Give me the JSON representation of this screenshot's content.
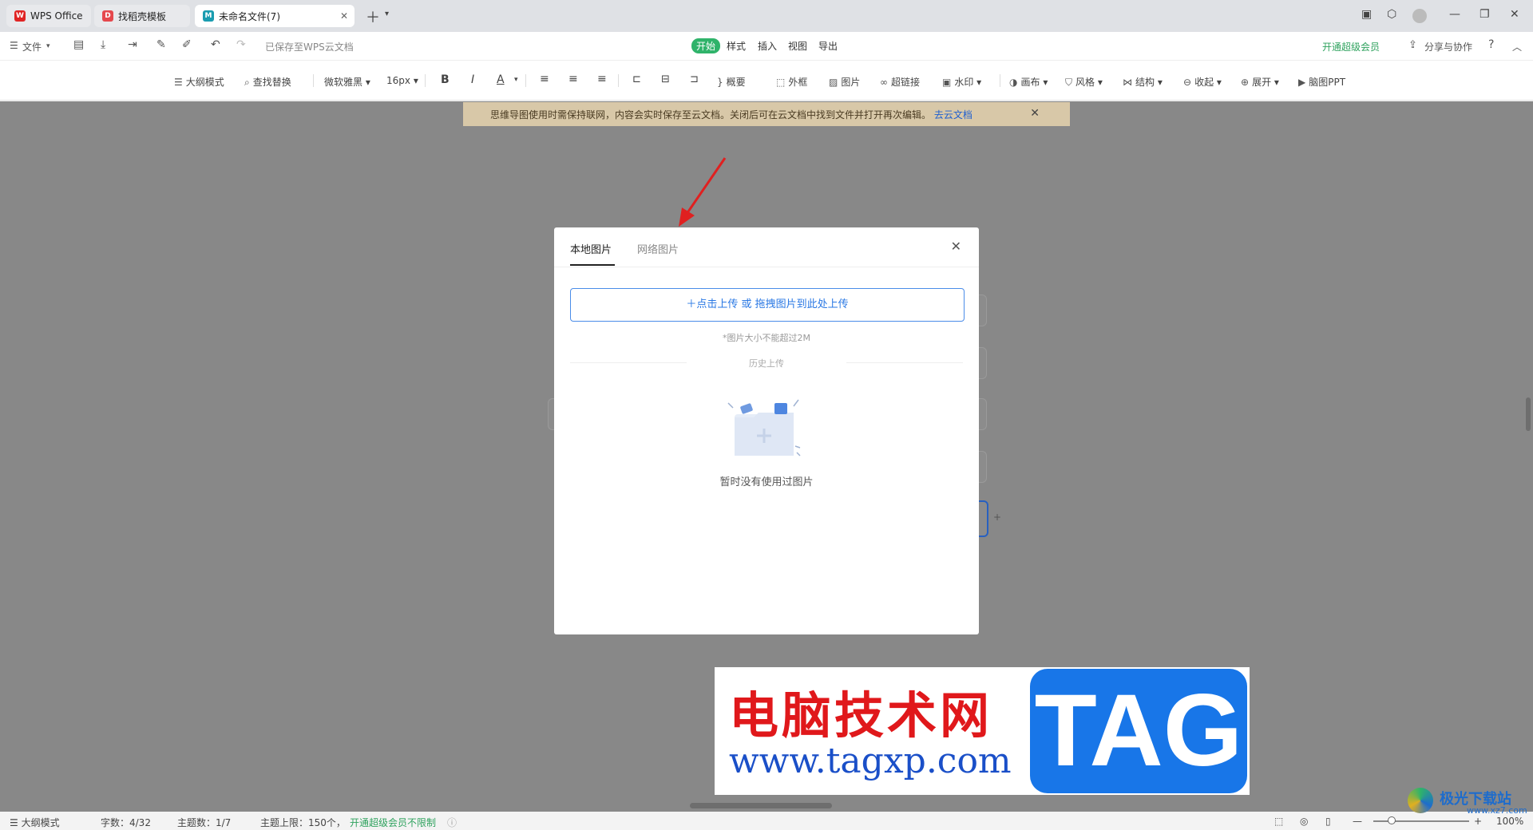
{
  "tabs": [
    {
      "label": "WPS Office"
    },
    {
      "label": "找稻壳模板"
    },
    {
      "label": "未命名文件(7)"
    }
  ],
  "menu": {
    "file": "文件",
    "saved": "已保存至WPS云文档",
    "tabs": [
      "开始",
      "样式",
      "插入",
      "视图",
      "导出"
    ],
    "vip": "开通超级会员",
    "share": "分享与协作",
    "help": "?"
  },
  "toolbar": {
    "outline": "大纲模式",
    "find": "查找替换",
    "font": "微软雅黑",
    "size": "16px",
    "bold": "B",
    "italic": "I",
    "color": "A",
    "summary": "概要",
    "frame": "外框",
    "image": "图片",
    "link": "超链接",
    "watermark": "水印",
    "canvas": "画布",
    "style": "风格",
    "structure": "结构",
    "collapse": "收起",
    "expand": "展开",
    "ppt": "脑图PPT"
  },
  "banner": {
    "text": "思维导图使用时需保持联网，内容会实时保存至云文档。关闭后可在云文档中找到文件并打开再次编辑。",
    "link": "去云文档",
    "close": "✕"
  },
  "dialog": {
    "tab_local": "本地图片",
    "tab_web": "网络图片",
    "close": "✕",
    "upload": "＋点击上传 或 拖拽图片到此处上传",
    "hint": "*图片大小不能超过2M",
    "history": "历史上传",
    "empty": "暂时没有使用过图片"
  },
  "status": {
    "outline": "大纲模式",
    "words": "字数：4/32",
    "topics": "主题数：1/7",
    "limit": "主题上限：150个，",
    "vip": "开通超级会员不限制",
    "zoom": "100%"
  },
  "watermark": {
    "cn": "电脑技术网",
    "url": "www.tagxp.com",
    "tag": "TAG",
    "site": "极光下载站",
    "site_url": "www.xz7.com"
  },
  "colors": {
    "accent": "#2fb36a",
    "link": "#2a78e4",
    "banner": "#d8c8a8"
  }
}
